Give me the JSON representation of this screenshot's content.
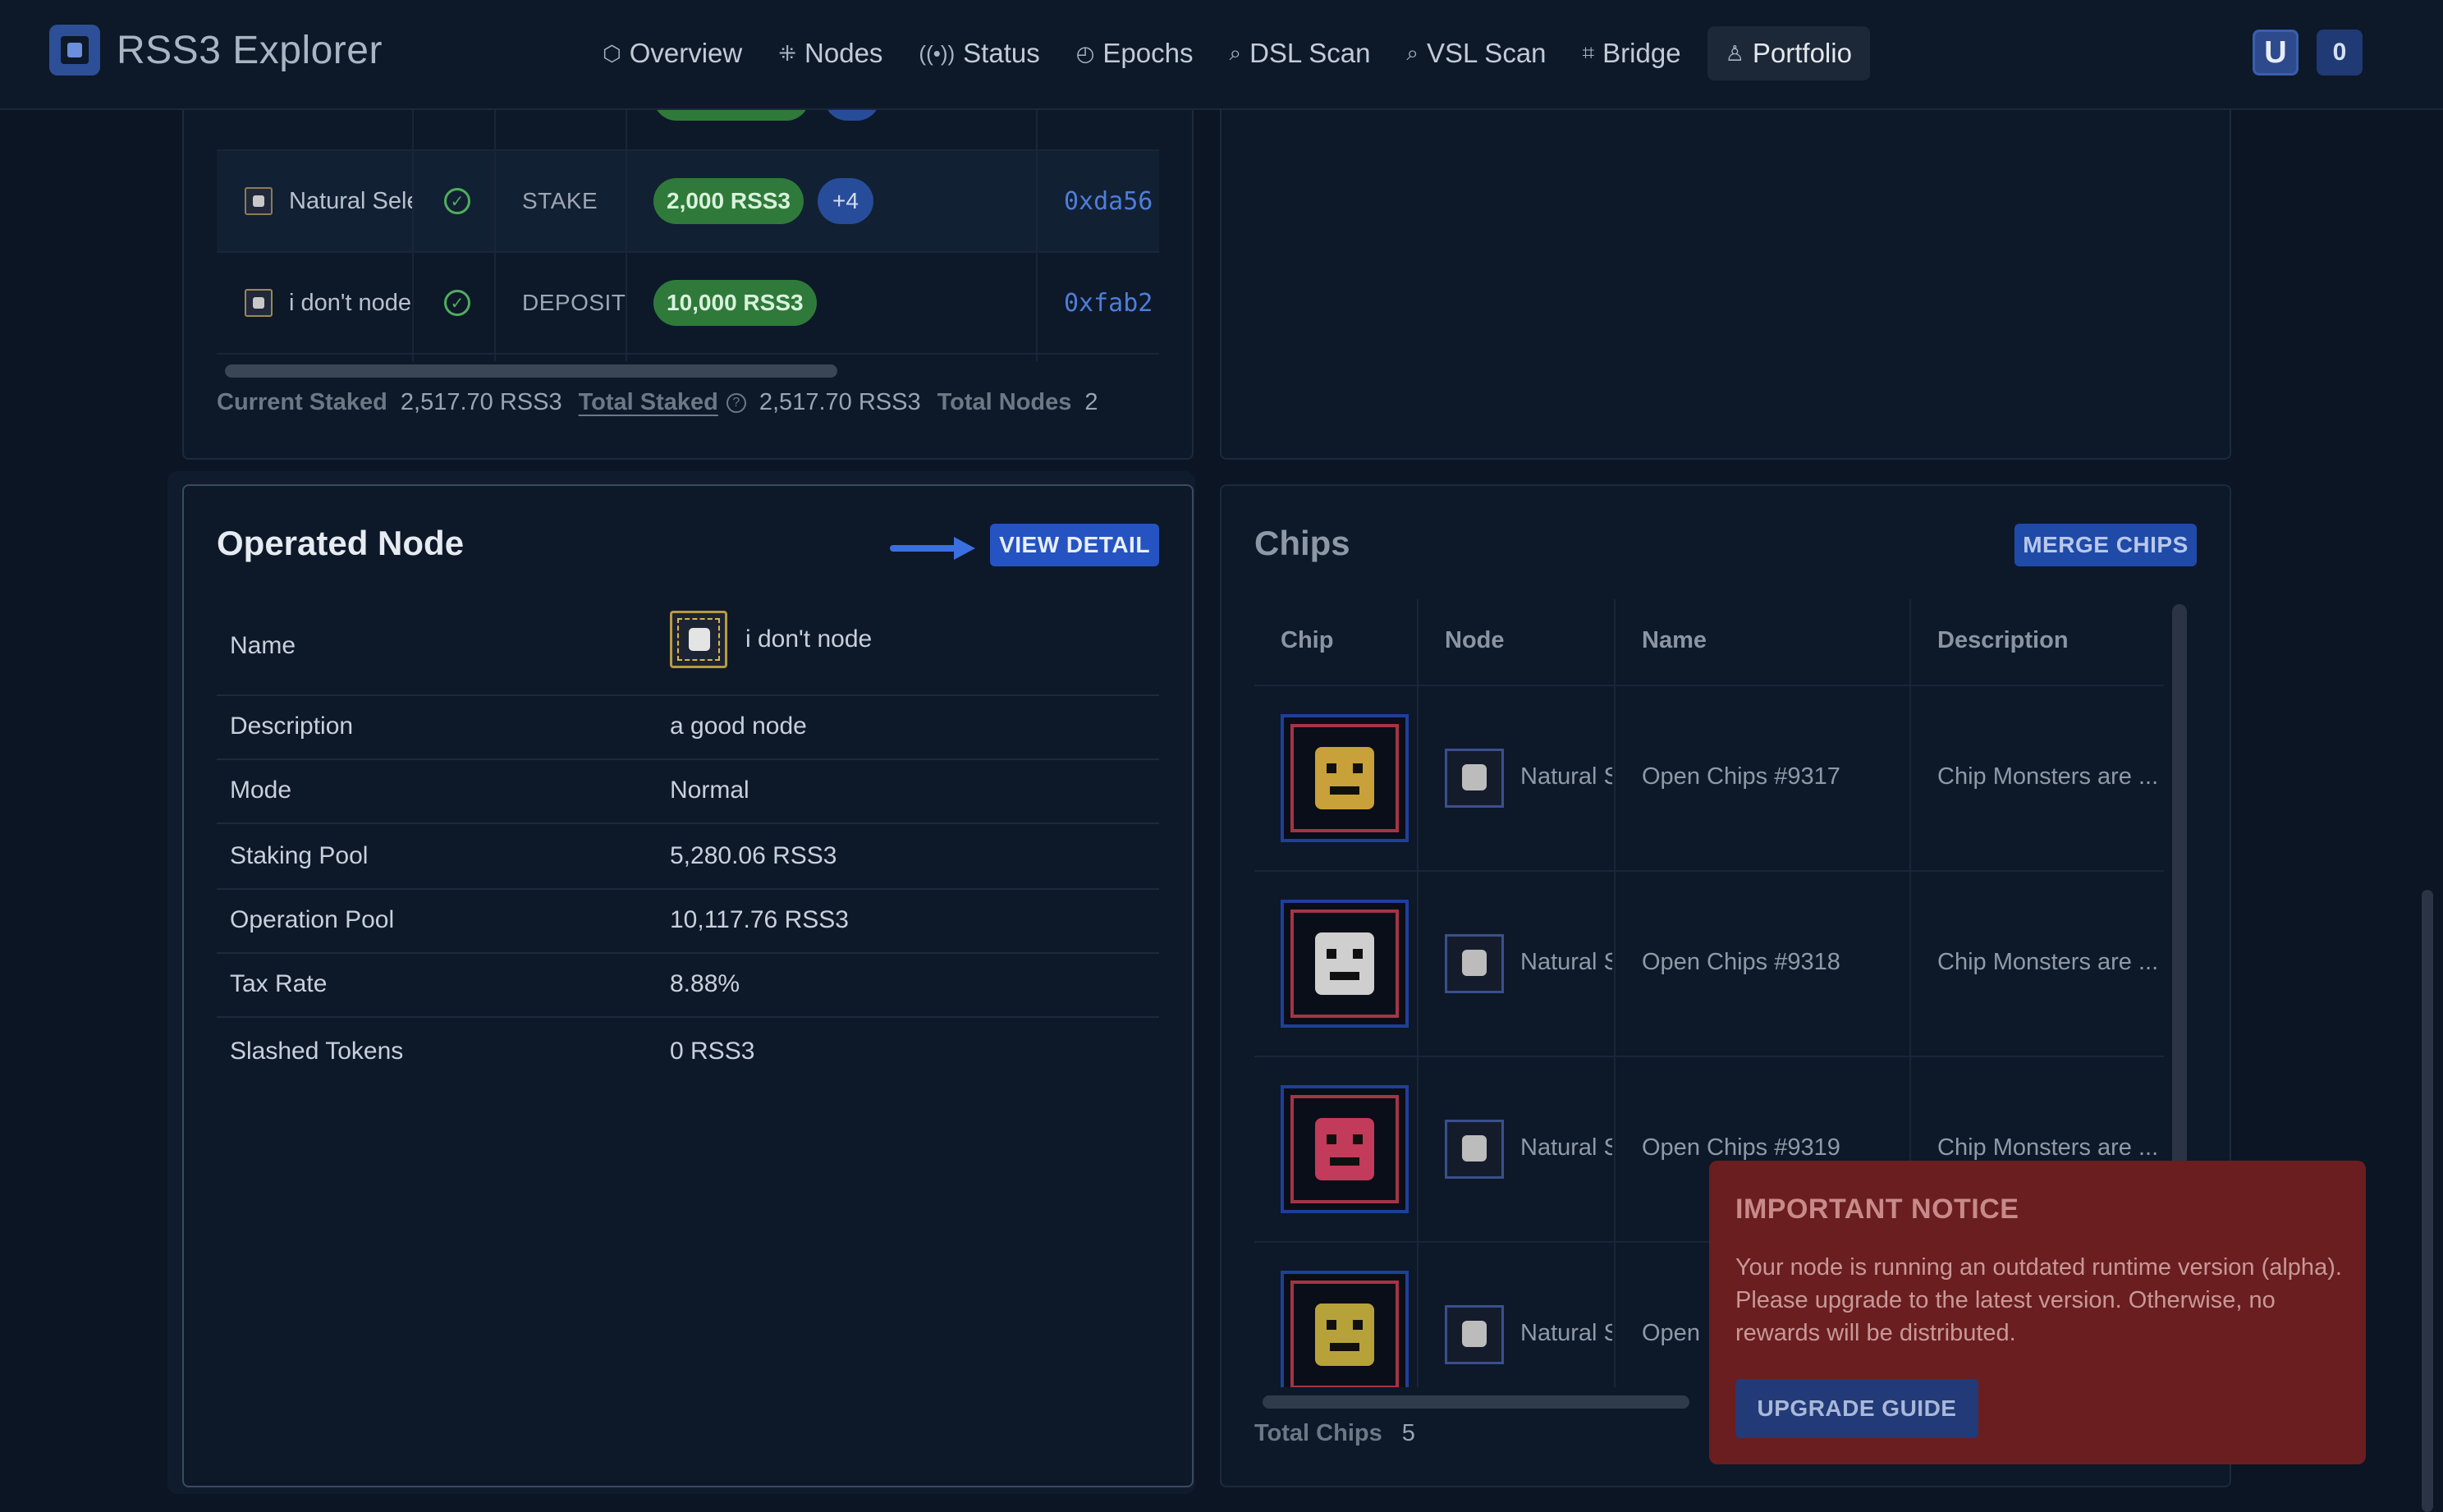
{
  "app": {
    "name": "RSS3 Explorer"
  },
  "nav": {
    "items": [
      {
        "label": "Overview",
        "icon": "cube-icon"
      },
      {
        "label": "Nodes",
        "icon": "nodes-icon"
      },
      {
        "label": "Status",
        "icon": "broadcast-icon"
      },
      {
        "label": "Epochs",
        "icon": "timer-icon"
      },
      {
        "label": "DSL Scan",
        "icon": "scan-icon"
      },
      {
        "label": "VSL Scan",
        "icon": "scan-icon"
      },
      {
        "label": "Bridge",
        "icon": "bridge-icon"
      },
      {
        "label": "Portfolio",
        "icon": "user-icon",
        "active": true
      }
    ]
  },
  "header_right": {
    "wallet_glyph": "U",
    "count": "0"
  },
  "staking": {
    "rows": [
      {
        "name": "Natural Selection",
        "type": "STAKE",
        "amount": "2,000 RSS3",
        "extra": "+4",
        "address": "0xda56"
      },
      {
        "name": "i don't node",
        "type": "DEPOSIT",
        "amount": "10,000 RSS3",
        "extra": "",
        "address": "0xfab2"
      }
    ],
    "summary": {
      "current_staked_label": "Current Staked",
      "current_staked_value": "2,517.70 RSS3",
      "total_staked_label": "Total Staked",
      "total_staked_value": "2,517.70 RSS3",
      "total_nodes_label": "Total Nodes",
      "total_nodes_value": "2"
    }
  },
  "operated_node": {
    "title": "Operated Node",
    "view_detail_label": "VIEW DETAIL",
    "name_label": "Name",
    "name_value": "i don't node",
    "rows": [
      {
        "label": "Description",
        "value": "a good node"
      },
      {
        "label": "Mode",
        "value": "Normal"
      },
      {
        "label": "Staking Pool",
        "value": "5,280.06 RSS3"
      },
      {
        "label": "Operation Pool",
        "value": "10,117.76 RSS3"
      },
      {
        "label": "Tax Rate",
        "value": "8.88%"
      },
      {
        "label": "Slashed Tokens",
        "value": "0 RSS3"
      }
    ]
  },
  "chips": {
    "title": "Chips",
    "merge_label": "MERGE CHIPS",
    "columns": [
      "Chip",
      "Node",
      "Name",
      "Description"
    ],
    "rows": [
      {
        "node": "Natural Selection",
        "name": "Open Chips #9317",
        "description": "Chip Monsters are ...",
        "face": "#c9a13a"
      },
      {
        "node": "Natural Selection",
        "name": "Open Chips #9318",
        "description": "Chip Monsters are ...",
        "face": "#cfcfcf"
      },
      {
        "node": "Natural Selection",
        "name": "Open Chips #9319",
        "description": "Chip Monsters are ...",
        "face": "#c23b5a"
      },
      {
        "node": "Natural Selection",
        "name": "Open",
        "description": "",
        "face": "#b7a23a"
      }
    ],
    "total_label": "Total Chips",
    "total_value": "5"
  },
  "notice": {
    "title": "IMPORTANT NOTICE",
    "body": "Your node is running an outdated runtime version (alpha). Please upgrade to the latest version. Otherwise, no rewards will be distributed.",
    "button_label": "UPGRADE GUIDE"
  }
}
